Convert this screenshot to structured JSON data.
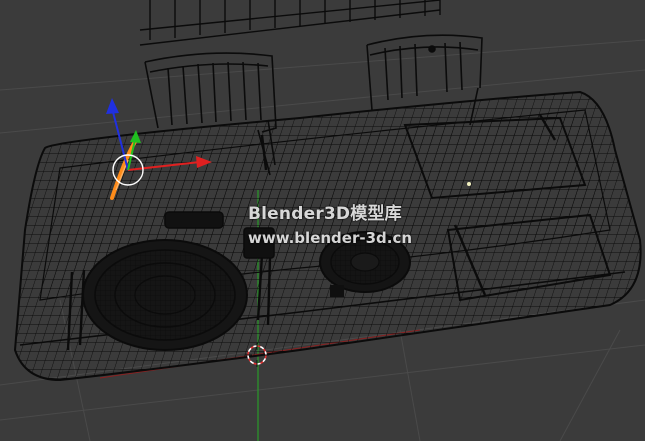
{
  "viewport": {
    "background_color": "#3a3a3a",
    "wire_color": "#0a0a0a",
    "grid_color": "#4a4a4a",
    "x_axis_color": "#b02020",
    "y_axis_color": "#2a9a2a"
  },
  "gizmo": {
    "x_axis_color": "#e02020",
    "y_axis_color": "#20c020",
    "z_axis_color": "#2030e0",
    "selected_object_color": "#ff8c1a"
  },
  "watermark": {
    "line1": "Blender3D模型库",
    "line2": "www.blender-3d.cn"
  }
}
